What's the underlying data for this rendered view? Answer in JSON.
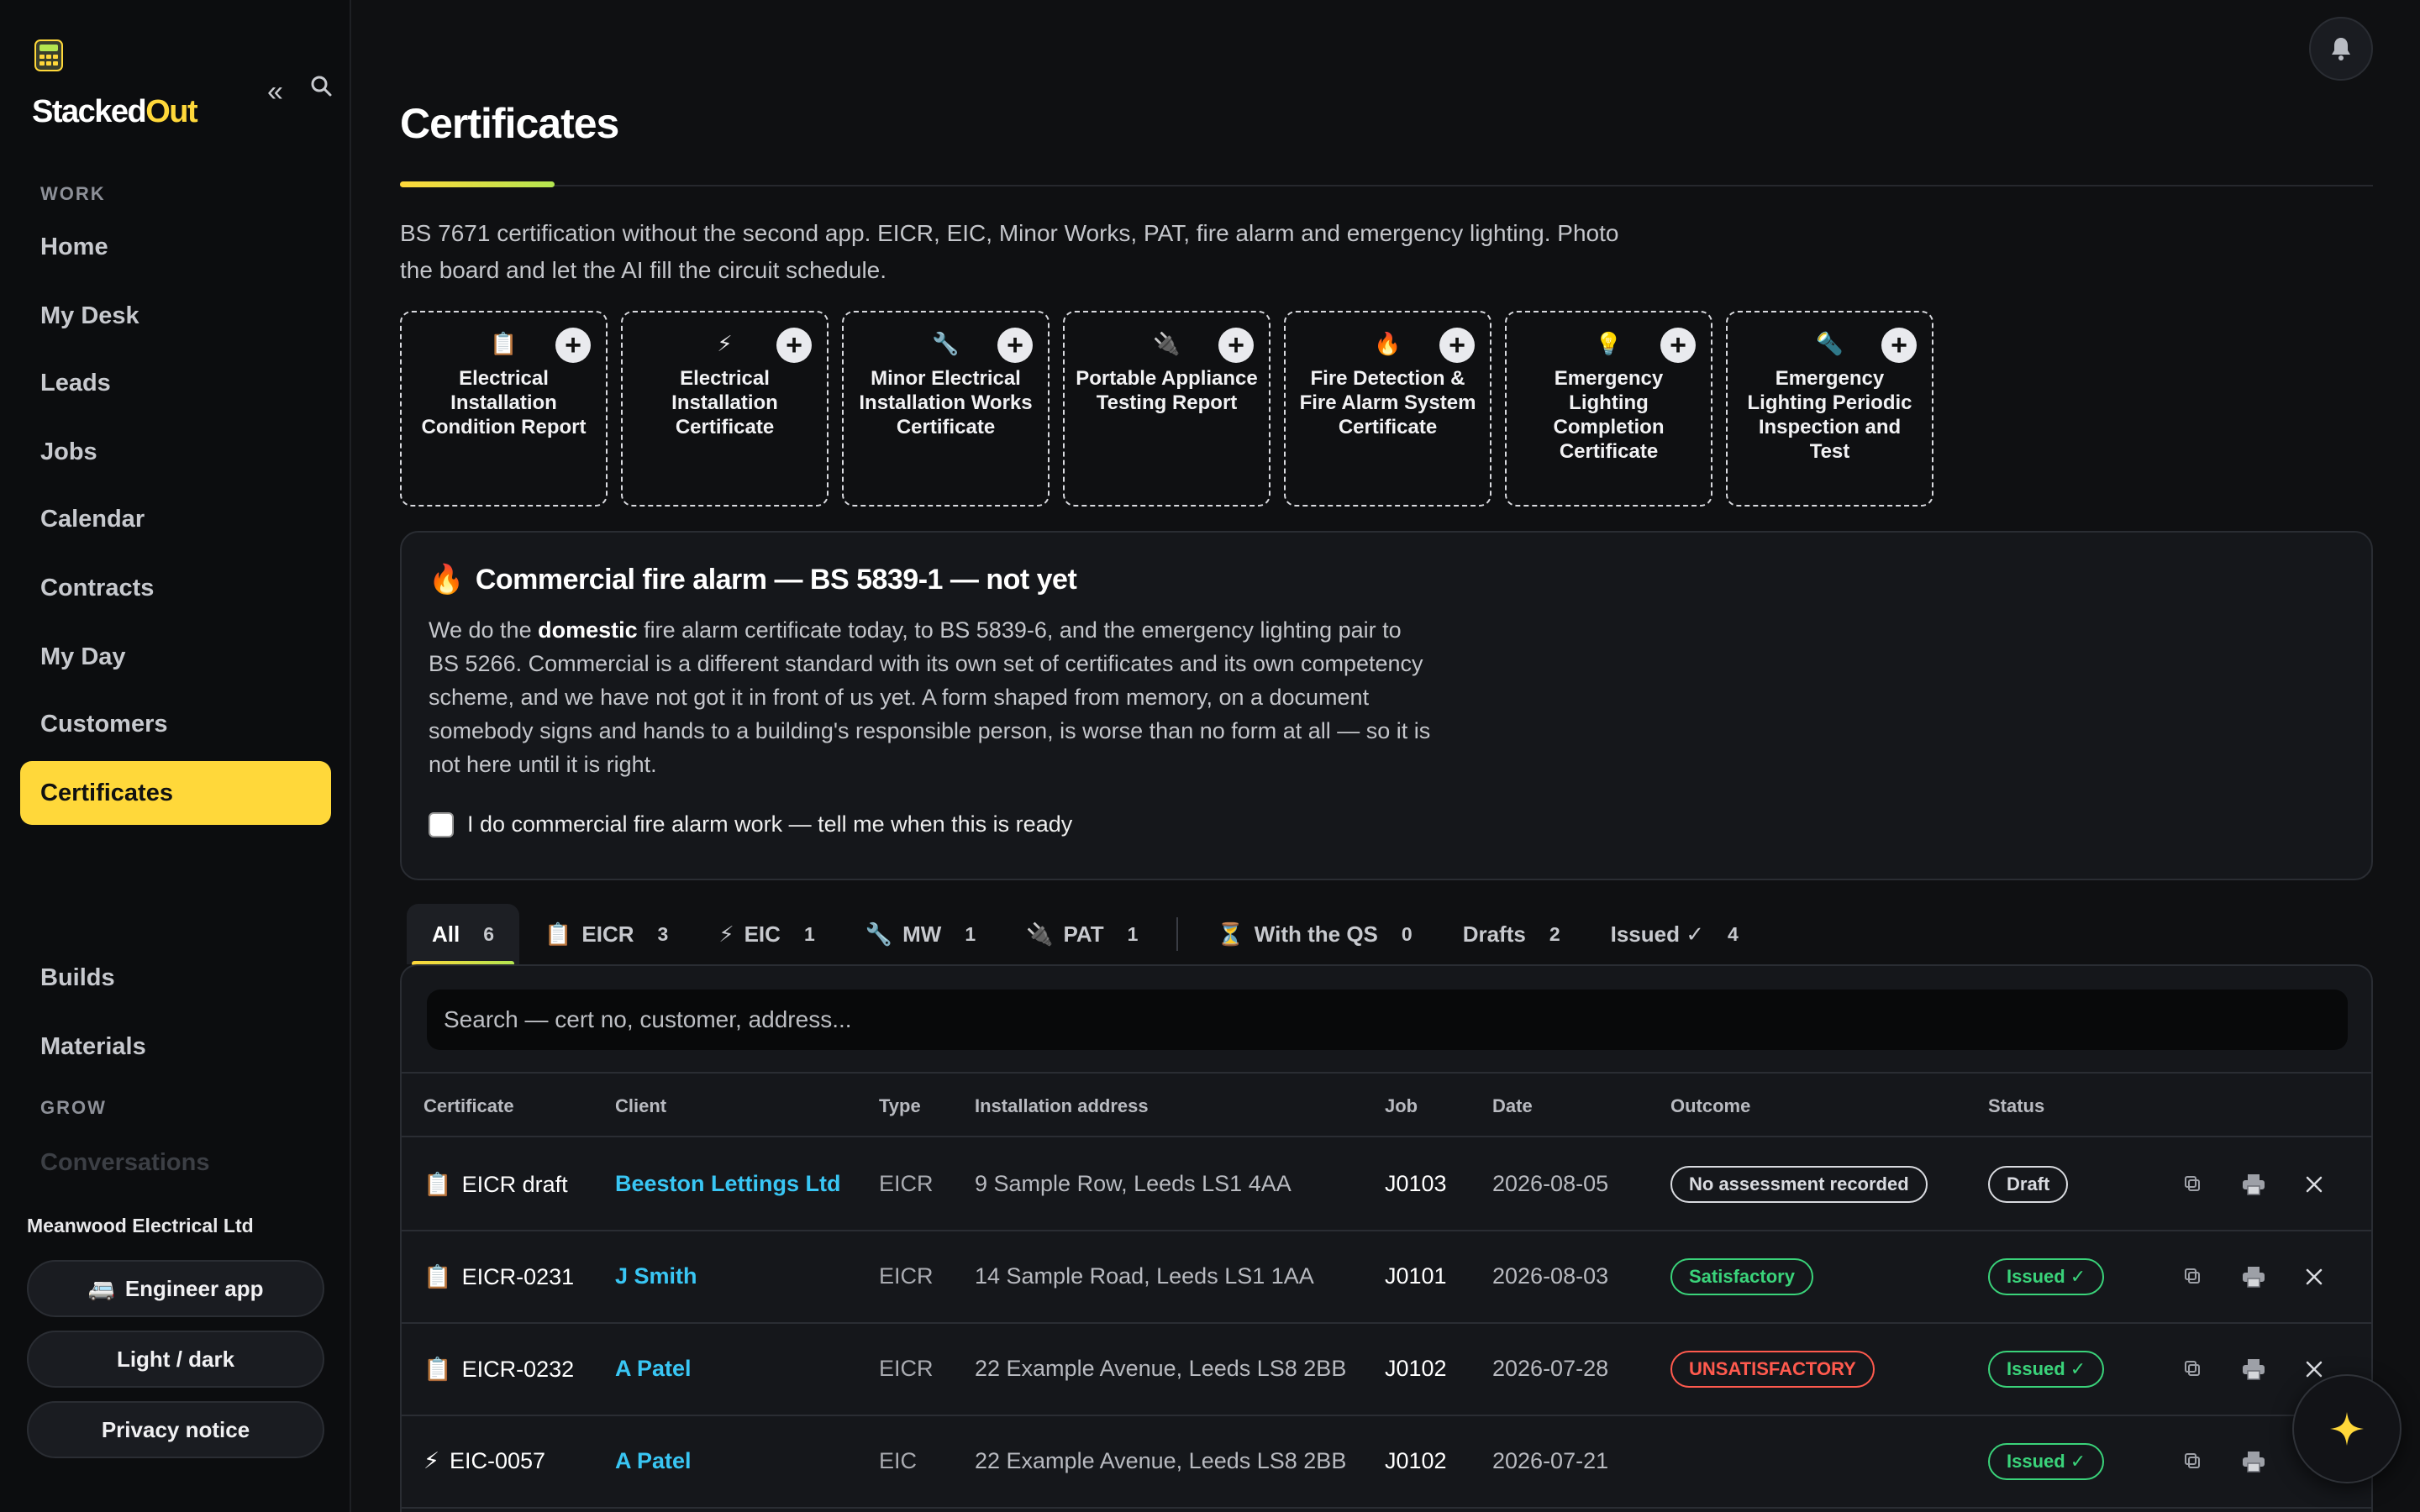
{
  "brand": {
    "part1": "Stacked",
    "part2": "Out",
    "logo_icon": "calculator-icon"
  },
  "sidebar": {
    "collapse_icon": "«",
    "sections": {
      "work": "WORK",
      "grow": "GROW"
    },
    "work_items": [
      {
        "label": "Home"
      },
      {
        "label": "My Desk"
      },
      {
        "label": "Leads"
      },
      {
        "label": "Jobs"
      },
      {
        "label": "Calendar"
      },
      {
        "label": "Contracts"
      },
      {
        "label": "My Day"
      },
      {
        "label": "Customers"
      },
      {
        "label": "Certificates",
        "active": true
      }
    ],
    "extra_items": [
      {
        "label": "Builds"
      },
      {
        "label": "Materials"
      }
    ],
    "grow_items": [
      {
        "label": "Conversations"
      }
    ],
    "org_name": "Meanwood Electrical Ltd",
    "buttons": {
      "engineer_app": "Engineer app",
      "engineer_icon": "🚐",
      "theme": "Light / dark",
      "privacy": "Privacy notice"
    }
  },
  "page": {
    "title": "Certificates",
    "intro": "BS 7671 certification without the second app. EICR, EIC, Minor Works, PAT, fire alarm and emergency lighting. Photo the board and let the AI fill the circuit schedule."
  },
  "cert_types": [
    {
      "icon": "📋",
      "label": "Electrical Installation Condition Report"
    },
    {
      "icon": "⚡",
      "label": "Electrical Installation Certificate"
    },
    {
      "icon": "🔧",
      "label": "Minor Electrical Installation Works Certificate"
    },
    {
      "icon": "🔌",
      "label": "Portable Appliance Testing Report"
    },
    {
      "icon": "🔥",
      "label": "Fire Detection & Fire Alarm System Certificate"
    },
    {
      "icon": "💡",
      "label": "Emergency Lighting Completion Certificate"
    },
    {
      "icon": "🔦",
      "label": "Emergency Lighting Periodic Inspection and Test"
    }
  ],
  "notice": {
    "icon": "🔥",
    "title": "Commercial fire alarm — BS 5839-1 — not yet",
    "body_pre": "We do the ",
    "body_bold": "domestic",
    "body_post": " fire alarm certificate today, to BS 5839-6, and the emergency lighting pair to BS 5266. Commercial is a different standard with its own set of certificates and its own competency scheme, and we have not got it in front of us yet. A form shaped from memory, on a document somebody signs and hands to a building's responsible person, is worse than no form at all — so it is not here until it is right.",
    "checkbox_label": "I do commercial fire alarm work — tell me when this is ready"
  },
  "tabs": [
    {
      "icon": "",
      "label": "All",
      "count": "6",
      "active": true
    },
    {
      "icon": "📋",
      "label": "EICR",
      "count": "3"
    },
    {
      "icon": "⚡",
      "label": "EIC",
      "count": "1"
    },
    {
      "icon": "🔧",
      "label": "MW",
      "count": "1"
    },
    {
      "icon": "🔌",
      "label": "PAT",
      "count": "1"
    },
    {
      "icon": "⏳",
      "label": "With the QS",
      "count": "0"
    },
    {
      "icon": "",
      "label": "Drafts",
      "count": "2"
    },
    {
      "icon": "",
      "label": "Issued ✓",
      "count": "4"
    }
  ],
  "search": {
    "placeholder": "Search — cert no, customer, address..."
  },
  "table": {
    "headers": [
      "Certificate",
      "Client",
      "Type",
      "Installation address",
      "Job",
      "Date",
      "Outcome",
      "Status"
    ],
    "rows": [
      {
        "icon": "📋",
        "cert": "EICR draft",
        "client": "Beeston Lettings Ltd",
        "type": "EICR",
        "address": "9 Sample Row, Leeds LS1 4AA",
        "job": "J0103",
        "date": "2026-08-05",
        "outcome": "No assessment recorded",
        "outcome_kind": "none",
        "status": "Draft",
        "status_kind": "draft",
        "deletable": true
      },
      {
        "icon": "📋",
        "cert": "EICR-0231",
        "client": "J Smith",
        "type": "EICR",
        "address": "14 Sample Road, Leeds LS1 1AA",
        "job": "J0101",
        "date": "2026-08-03",
        "outcome": "Satisfactory",
        "outcome_kind": "sat",
        "status": "Issued ✓",
        "status_kind": "issued",
        "deletable": true
      },
      {
        "icon": "📋",
        "cert": "EICR-0232",
        "client": "A Patel",
        "type": "EICR",
        "address": "22 Example Avenue, Leeds LS8 2BB",
        "job": "J0102",
        "date": "2026-07-28",
        "outcome": "UNSATISFACTORY",
        "outcome_kind": "unsat",
        "status": "Issued ✓",
        "status_kind": "issued",
        "deletable": true
      },
      {
        "icon": "⚡",
        "cert": "EIC-0057",
        "client": "A Patel",
        "type": "EIC",
        "address": "22 Example Avenue, Leeds LS8 2BB",
        "job": "J0102",
        "date": "2026-07-21",
        "outcome": "",
        "outcome_kind": "",
        "status": "Issued ✓",
        "status_kind": "issued",
        "deletable": false
      }
    ]
  },
  "colors": {
    "accent": "#ffd83a",
    "link": "#39c6f4",
    "ok": "#3ad37a",
    "bad": "#ff5a4e"
  }
}
